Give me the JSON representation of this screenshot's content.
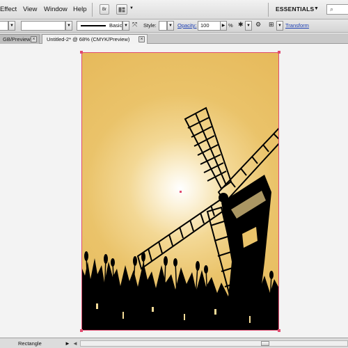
{
  "menubar": {
    "items": [
      "Effect",
      "View",
      "Window",
      "Help"
    ],
    "bridge_button": "Br",
    "workspace": "ESSENTIALS",
    "workspace_arrow": "▼"
  },
  "controlbar": {
    "brush_label": "Basic",
    "style_label": "Style:",
    "opacity_label": "Opacity:",
    "opacity_value": "100",
    "percent": "%",
    "transform_link": "Transform"
  },
  "tabs": [
    {
      "label": "GB/Preview)",
      "active": false
    },
    {
      "label": "Untitled-2* @ 68% (CMYK/Preview)",
      "active": true
    }
  ],
  "tab_close_glyph": "×",
  "statusbar": {
    "tool_label": "Rectangle",
    "arrow": "►",
    "scroll_left": "◄"
  },
  "artwork": {
    "subject": "windmill silhouette",
    "colors": {
      "sky_center": "#ffffff",
      "sky_edge": "#e6b95a",
      "silhouette": "#000000",
      "selection": "#e04b6f"
    }
  },
  "icons": {
    "search": "magnifier-icon",
    "arrange": "arrange-documents-icon",
    "transform": "transform-icon",
    "recolor": "recolor-icon"
  }
}
